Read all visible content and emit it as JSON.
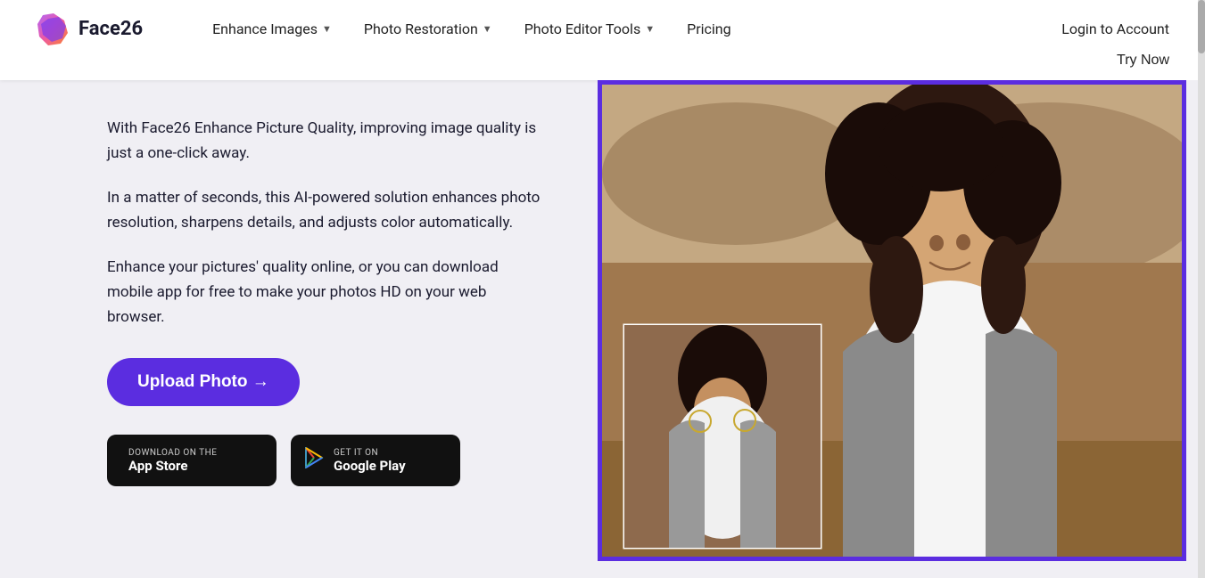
{
  "header": {
    "logo_text": "Face26",
    "nav_items": [
      {
        "label": "Enhance Images",
        "has_dropdown": true
      },
      {
        "label": "Photo Restoration",
        "has_dropdown": true
      },
      {
        "label": "Photo Editor Tools",
        "has_dropdown": true
      },
      {
        "label": "Pricing",
        "has_dropdown": false
      }
    ],
    "login_label": "Login to Account",
    "try_now_label": "Try Now"
  },
  "hero": {
    "desc1": "With Face26 Enhance Picture Quality, improving image quality is just a one-click away.",
    "desc2": "In a matter of seconds, this AI-powered solution enhances photo resolution, sharpens details, and adjusts color automatically.",
    "desc3": "Enhance your pictures' quality online, or you can download mobile app for free to make your photos HD on your web browser.",
    "upload_btn": "Upload Photo →",
    "badge_app_store": {
      "sub": "Download on the",
      "main": "App Store"
    },
    "badge_google_play": {
      "sub": "GET IT ON",
      "main": "Google Play"
    }
  }
}
